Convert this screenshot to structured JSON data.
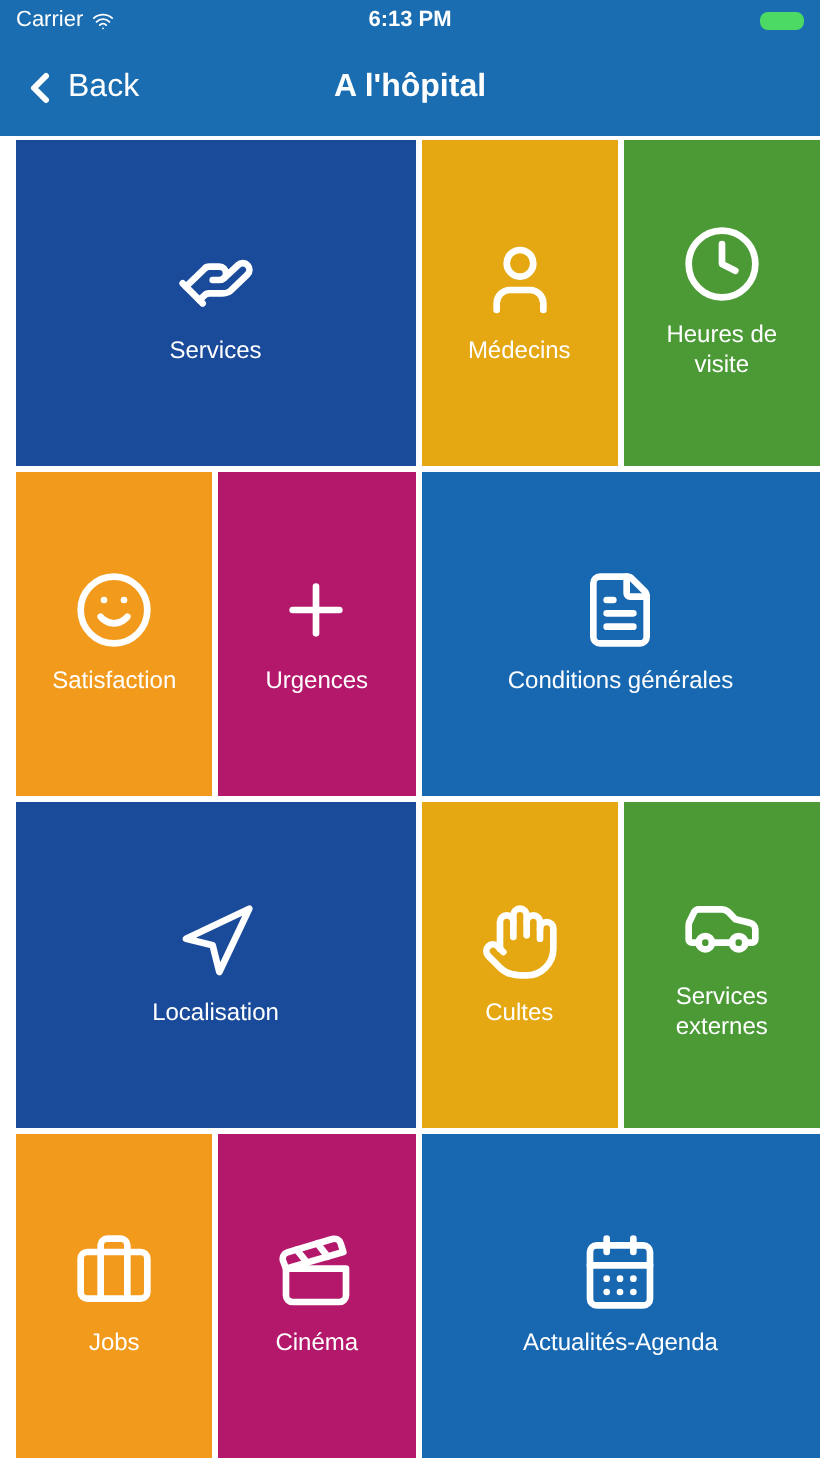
{
  "status_bar": {
    "carrier": "Carrier",
    "time": "6:13 PM"
  },
  "nav": {
    "back": "Back",
    "title": "A l'hôpital"
  },
  "tiles": [
    {
      "label": "Services",
      "kind": "large",
      "color": "#1a4a9a"
    },
    {
      "label": "Médecins",
      "kind": "small",
      "color": "#e5a812"
    },
    {
      "label": "Heures de visite",
      "kind": "small",
      "color": "#4b9a36"
    },
    {
      "label": "Satisfaction",
      "kind": "small",
      "color": "#f29a1c"
    },
    {
      "label": "Urgences",
      "kind": "small",
      "color": "#b3186b"
    },
    {
      "label": "Conditions générales",
      "kind": "large",
      "color": "#1767b1"
    },
    {
      "label": "Localisation",
      "kind": "large",
      "color": "#1a4a9a"
    },
    {
      "label": "Cultes",
      "kind": "small",
      "color": "#e5a812"
    },
    {
      "label": "Services externes",
      "kind": "small",
      "color": "#4b9a36"
    },
    {
      "label": "Jobs",
      "kind": "small",
      "color": "#f29a1c"
    },
    {
      "label": "Cinéma",
      "kind": "small",
      "color": "#b3186b"
    },
    {
      "label": "Actualités-Agenda",
      "kind": "large",
      "color": "#1767b1"
    }
  ]
}
